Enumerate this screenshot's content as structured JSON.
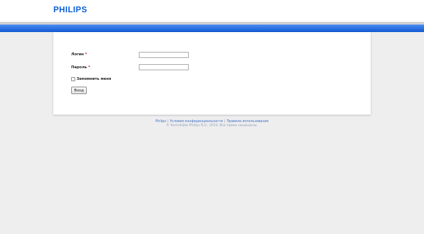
{
  "header": {
    "logo_text": "PHILIPS"
  },
  "colors": {
    "brand_blue": "#0b5ed7",
    "band_blue": "#1f63d8",
    "background": "#eeeeef"
  },
  "form": {
    "login_label": "Логин",
    "password_label": "Пароль",
    "required_marker": "*",
    "login_value": "",
    "password_value": "",
    "remember_label": "Запомнить меня",
    "remember_checked": false,
    "submit_label": "Вход"
  },
  "footer": {
    "links": [
      "Philips",
      "Условия конфиденциальности",
      "Правила использования"
    ],
    "separator": "|",
    "copyright": "© Koninklijke Philips N.V., 2019. Все права защищены."
  }
}
